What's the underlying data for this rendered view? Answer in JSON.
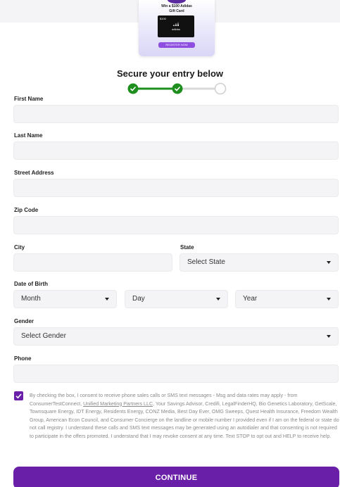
{
  "promo": {
    "title_line1": "Win a $100 Adidas",
    "title_line2": "Gift Card",
    "card_amount": "$100",
    "card_brand": "adidas",
    "button_label": "REGISTER NOW"
  },
  "form": {
    "section_title": "Secure your entry below",
    "progress": {
      "current_step": 2,
      "total_steps": 3
    },
    "first_name": {
      "label": "First Name",
      "value": ""
    },
    "last_name": {
      "label": "Last Name",
      "value": ""
    },
    "street_address": {
      "label": "Street Address",
      "value": ""
    },
    "zip_code": {
      "label": "Zip Code",
      "value": ""
    },
    "city": {
      "label": "City",
      "value": ""
    },
    "state": {
      "label": "State",
      "selected": "Select State"
    },
    "date_of_birth": {
      "label": "Date of Birth",
      "month": "Month",
      "day": "Day",
      "year": "Year"
    },
    "gender": {
      "label": "Gender",
      "selected": "Select Gender"
    },
    "phone": {
      "label": "Phone",
      "value": ""
    }
  },
  "consent": {
    "checked": true,
    "text_before_link": "By checking the box, I consent to receive phone sales calls or SMS text messages - Msg and data rates may apply - from ConsumerTestConnect, ",
    "link_text": "Unified Marketing Partners LLC",
    "text_after_link": ", Your Savings Advisor, Credifi, LegalFinderHQ, Bio Genetics Laboratory, GetScale, Townsquare Energy, IDT Energy, Residents Energy, CONZ Media, Best Day Ever, OMG Sweeps, Quest Health Insurance, Freedom Wealth Group, American Econ Council, and Consumer Concierge on the landline or mobile number I provided even if I am on the federal or state do not call registry. I understand these calls and SMS text messages may be generated using an autodialer and that consenting is not required to participate in the offers promoted. I understand that I may revoke consent at any time. Text STOP to opt out and HELP to receive help."
  },
  "continue_label": "CONTINUE",
  "colors": {
    "brand_purple": "#6a1fa8",
    "step_complete": "#1e8f1e",
    "field_bg": "#f4f4f6"
  }
}
